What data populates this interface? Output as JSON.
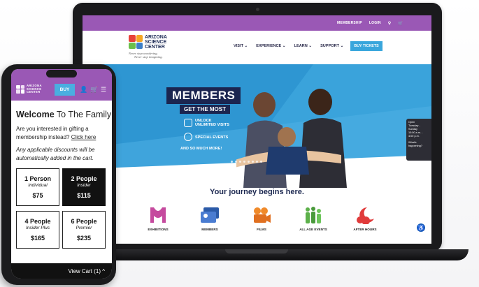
{
  "site": {
    "logo_line1": "ARIZONA",
    "logo_line2": "SCIENCE",
    "logo_line3": "CENTER",
    "tagline_line1": "Never stop wondering.",
    "tagline_line2": "Never stop imagining.",
    "colors": {
      "purple": "#9a58b5",
      "blue": "#3aa3db",
      "navy": "#1b2550",
      "buy": "#39a6dc"
    }
  },
  "desktop": {
    "top_links": {
      "membership": "MEMBERSHIP",
      "login": "LOGIN"
    },
    "nav": {
      "visit": "VISIT ⌄",
      "experience": "EXPERIENCE ⌄",
      "learn": "LEARN ⌄",
      "support": "SUPPORT ⌄",
      "buy": "BUY TICKETS"
    },
    "hero": {
      "members": "MEMBERS",
      "get_most": "GET THE MOST",
      "perk1_line1": "UNLOCK",
      "perk1_line2": "UNLIMITED VISITS",
      "perk2": "SPECIAL EVENTS",
      "perk3": "AND SO MUCH MORE!"
    },
    "side_card": {
      "line1": "Open",
      "line2": "Tuesday -",
      "line3": "Sunday",
      "line4": "10:00 a.m. -",
      "line5": "4:00 p.m.",
      "line6": "What's",
      "line7": "happening?"
    },
    "journey": "Your journey begins here.",
    "categories": [
      {
        "label": "EXHIBITIONS",
        "icon": "exhibition-icon",
        "color": "#c54a9e"
      },
      {
        "label": "MEMBERS",
        "icon": "members-card-icon",
        "color": "#2b5aa8"
      },
      {
        "label": "FILMS",
        "icon": "film-camera-icon",
        "color": "#f08a2a"
      },
      {
        "label": "ALL AGE EVENTS",
        "icon": "people-icon",
        "color": "#5cb04a"
      },
      {
        "label": "AFTER HOURS",
        "icon": "moon-icon",
        "color": "#e03b3b"
      }
    ]
  },
  "mobile": {
    "logo_line1": "ARIZONA",
    "logo_line2": "SCIENCE",
    "logo_line3": "CENTER",
    "buy": "BUY",
    "title_bold": "Welcome",
    "title_rest": " To The Family",
    "gift_text": "Are you interested in gifting a membership instead?",
    "gift_link": "Click here",
    "note": "Any applicable discounts will be automatically added in the cart.",
    "cards": [
      {
        "name": "1 Person",
        "tier": "Individual",
        "price": "$75"
      },
      {
        "name": "2 People",
        "tier": "Insider",
        "price": "$115"
      },
      {
        "name": "4 People",
        "tier": "Insider Plus",
        "price": "$165"
      },
      {
        "name": "6 People",
        "tier": "Premier",
        "price": "$235"
      }
    ],
    "cart": "View Cart (1) ^"
  }
}
